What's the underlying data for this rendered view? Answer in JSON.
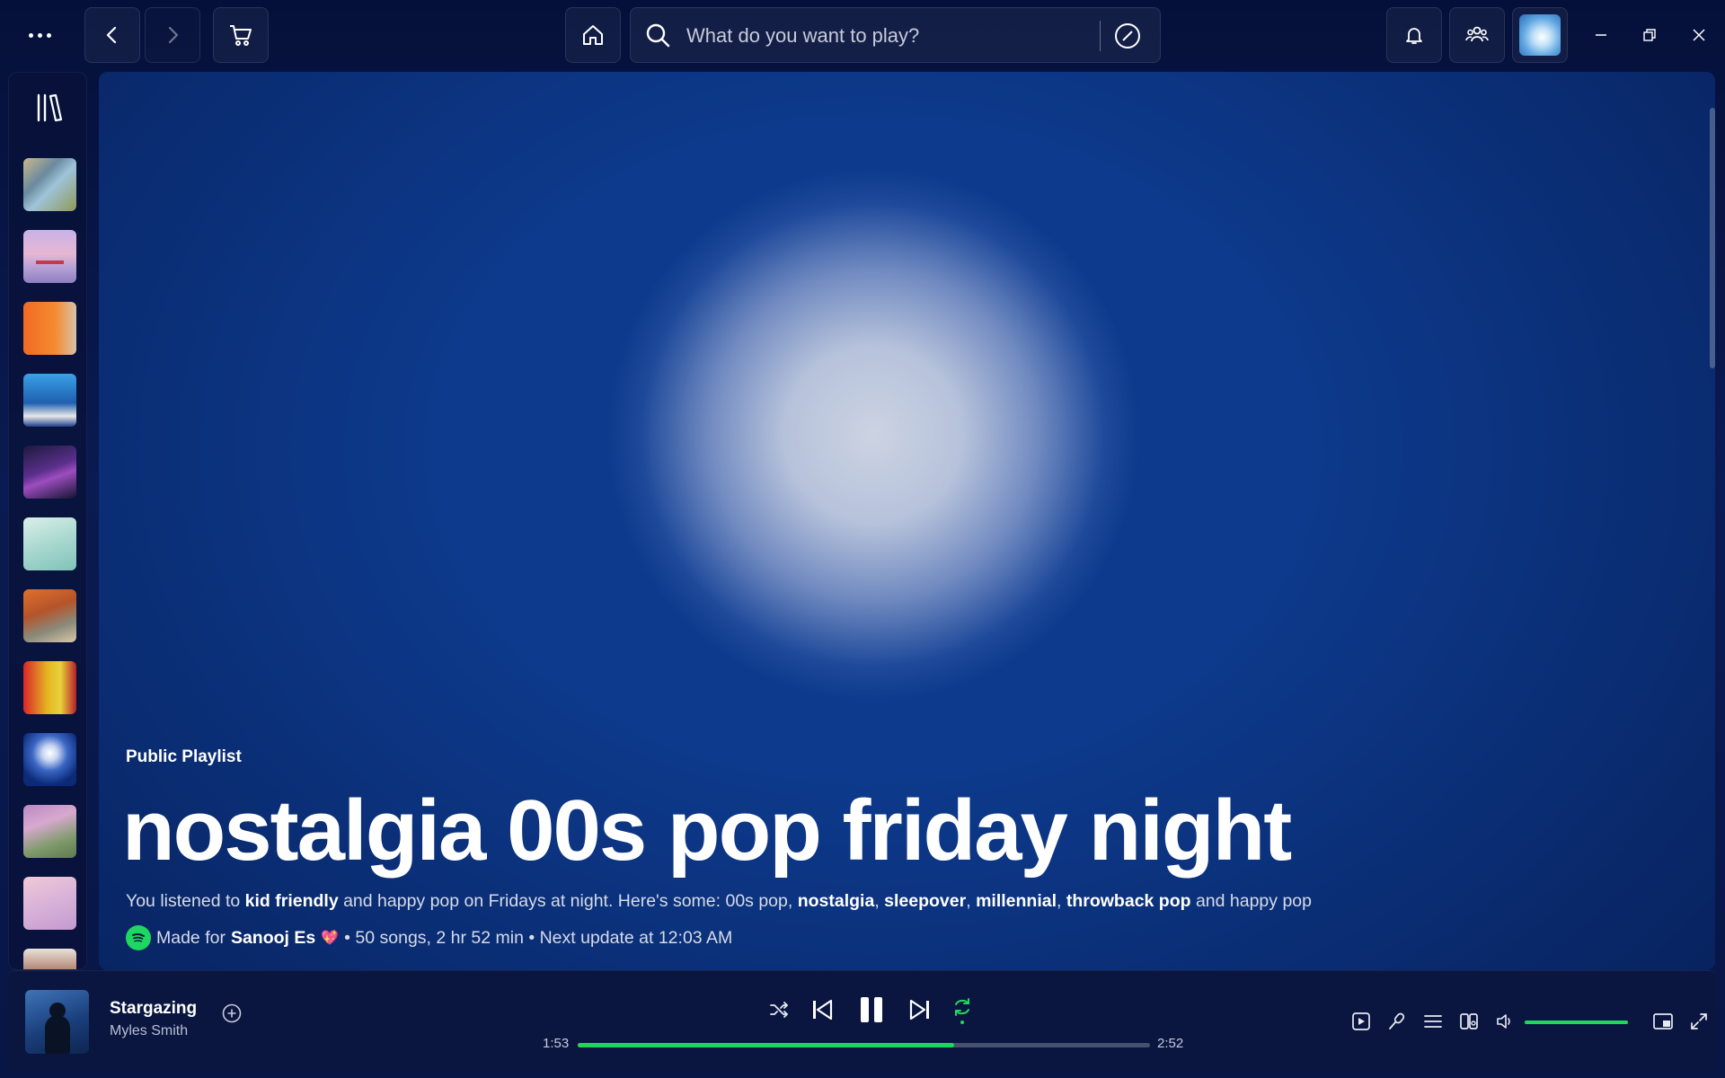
{
  "search": {
    "placeholder": "What do you want to play?"
  },
  "colors": {
    "accent": "#1ed760",
    "background": "#0a1a52",
    "hero_glow": "#ccd3e2"
  },
  "topbar_icons": [
    "more-icon",
    "back-icon",
    "forward-icon",
    "cart-icon",
    "home-icon",
    "search-icon",
    "browse-icon",
    "bell-icon",
    "friends-icon",
    "avatar",
    "minimize-icon",
    "restore-icon",
    "close-icon"
  ],
  "sidebar": {
    "items": [
      {
        "name": "library-item-1"
      },
      {
        "name": "library-item-2"
      },
      {
        "name": "library-item-3"
      },
      {
        "name": "library-item-4"
      },
      {
        "name": "library-item-5"
      },
      {
        "name": "library-item-6"
      },
      {
        "name": "library-item-7"
      },
      {
        "name": "library-item-8"
      },
      {
        "name": "library-item-9"
      },
      {
        "name": "library-item-10"
      },
      {
        "name": "library-item-11"
      },
      {
        "name": "library-item-12"
      }
    ]
  },
  "playlist": {
    "type_label": "Public Playlist",
    "title": "nostalgia 00s pop friday night",
    "description": {
      "p1": "You listened to ",
      "tag1": "kid friendly",
      "p2": " and happy pop on Fridays at night. Here's some: 00s pop, ",
      "tag2": "nostalgia",
      "sep1": ", ",
      "tag3": "sleepover",
      "sep2": ", ",
      "tag4": "millennial",
      "sep3": ", ",
      "tag5": "throwback pop",
      "p3": " and happy pop"
    },
    "meta": {
      "made_for": "Made for",
      "user": "Sanooj Es",
      "heart": "💖",
      "stats": "• 50 songs, 2 hr 52 min • Next update at 12:03 AM"
    }
  },
  "player": {
    "track_title": "Stargazing",
    "artist": "Myles Smith",
    "elapsed": "1:53",
    "duration": "2:52",
    "progress_fraction": 0.657,
    "volume_fraction": 1.0,
    "state": "playing",
    "repeat": "on"
  }
}
